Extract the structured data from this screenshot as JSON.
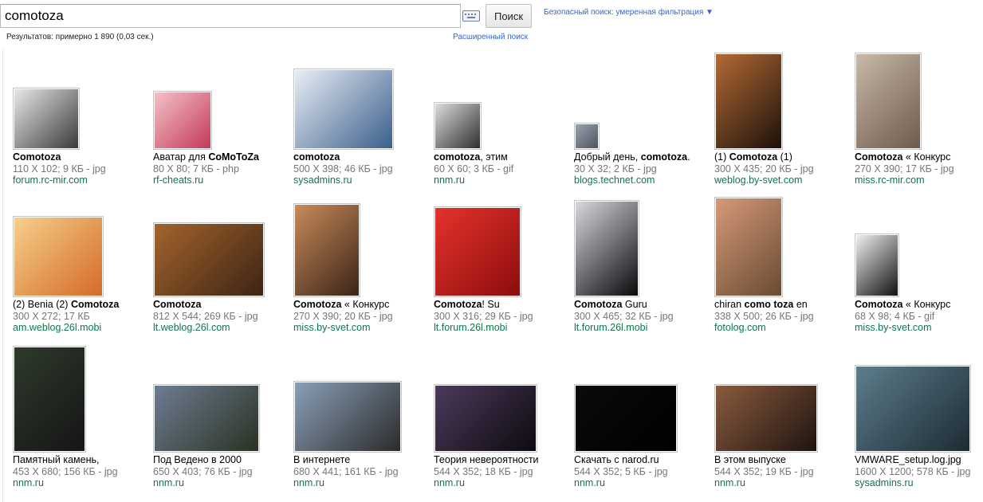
{
  "search": {
    "query": "comotoza",
    "button_label": "Поиск"
  },
  "safe_search": "Безопасный поиск: умеренная фильтрация ▼",
  "stats": "Результатов: примерно 1 890 (0,03 сек.)",
  "advanced_search": "Расширенный поиск",
  "results": [
    {
      "pre": "",
      "bold": "Comotoza",
      "post": "",
      "meta": "110 X 102; 9 КБ - jpg",
      "domain": "forum.rc-mir.com",
      "colors": [
        "#e8e8e8",
        "#3a3a3a"
      ]
    },
    {
      "pre": "Аватар для ",
      "bold": "CoMoToZa",
      "post": "",
      "meta": "80 X 80; 7 КБ - php",
      "domain": "rf-cheats.ru",
      "colors": [
        "#f3c1c6",
        "#c43a5a"
      ]
    },
    {
      "pre": "",
      "bold": "comotoza",
      "post": "",
      "meta": "500 X 398; 46 КБ - jpg",
      "domain": "sysadmins.ru",
      "colors": [
        "#e9eef5",
        "#3b5f8c"
      ]
    },
    {
      "pre": "",
      "bold": "comotoza",
      "post": ", этим",
      "meta": "60 X 60; 3 КБ - gif",
      "domain": "nnm.ru",
      "colors": [
        "#dcdcdc",
        "#2e2e2e"
      ]
    },
    {
      "pre": "Добрый день, ",
      "bold": "comotoza",
      "post": ".",
      "meta": "30 X 32; 2 КБ - jpg",
      "domain": "blogs.technet.com",
      "colors": [
        "#9aa3ad",
        "#4b5560"
      ]
    },
    {
      "pre": "(1) ",
      "bold": "Comotoza",
      "post": " (1)",
      "meta": "300 X 435; 20 КБ - jpg",
      "domain": "weblog.by-svet.com",
      "colors": [
        "#b46a35",
        "#1c110b"
      ]
    },
    {
      "pre": "",
      "bold": "Comotoza",
      "post": " « Конкурс",
      "meta": "270 X 390; 17 КБ - jpg",
      "domain": "miss.rc-mir.com",
      "colors": [
        "#c8b9a8",
        "#6d5a4d"
      ]
    },
    {
      "pre": "(2) Benia (2) ",
      "bold": "Comotoza",
      "post": "",
      "meta": "300 X 272; 17 КБ",
      "domain": "am.weblog.26l.mobi",
      "colors": [
        "#f5d08a",
        "#d66a2a"
      ]
    },
    {
      "pre": "",
      "bold": "Comotoza",
      "post": "",
      "meta": "812 X 544; 269 КБ - jpg",
      "domain": "lt.weblog.26l.com",
      "colors": [
        "#a3642d",
        "#3d2414"
      ]
    },
    {
      "pre": "",
      "bold": "Comotoza",
      "post": " « Конкурс",
      "meta": "270 X 390; 20 КБ - jpg",
      "domain": "miss.by-svet.com",
      "colors": [
        "#c98a5b",
        "#3a2418"
      ]
    },
    {
      "pre": "",
      "bold": "Comotoza",
      "post": "! Su",
      "meta": "300 X 316; 29 КБ - jpg",
      "domain": "lt.forum.26l.mobi",
      "colors": [
        "#e5322c",
        "#8c0d0d"
      ]
    },
    {
      "pre": "",
      "bold": "Comotoza",
      "post": " Guru",
      "meta": "300 X 465; 32 КБ - jpg",
      "domain": "lt.forum.26l.mobi",
      "colors": [
        "#d8d8e0",
        "#0a0a0c"
      ]
    },
    {
      "pre": "chiran ",
      "bold": "como toza",
      "post": " en",
      "meta": "338 X 500; 26 КБ - jpg",
      "domain": "fotolog.com",
      "colors": [
        "#d59a78",
        "#6a4a32"
      ]
    },
    {
      "pre": "",
      "bold": "Comotoza",
      "post": " « Конкурс",
      "meta": "68 X 98; 4 КБ - gif",
      "domain": "miss.by-svet.com",
      "colors": [
        "#f0f0f0",
        "#111111"
      ]
    },
    {
      "pre": "Памятный камень,",
      "bold": "",
      "post": "",
      "meta": "453 X 680; 156 КБ - jpg",
      "domain": "nnm.ru",
      "colors": [
        "#2e3a2c",
        "#151515"
      ]
    },
    {
      "pre": "Под Ведено в 2000",
      "bold": "",
      "post": "",
      "meta": "650 X 403; 76 КБ - jpg",
      "domain": "nnm.ru",
      "colors": [
        "#6e7c92",
        "#2a3222"
      ]
    },
    {
      "pre": "В интернете",
      "bold": "",
      "post": "",
      "meta": "680 X 441; 161 КБ - jpg",
      "domain": "nnm.ru",
      "colors": [
        "#8aa0b8",
        "#2b2b2b"
      ]
    },
    {
      "pre": "Теория невероятности",
      "bold": "",
      "post": "",
      "meta": "544 X 352; 18 КБ - jpg",
      "domain": "nnm.ru",
      "colors": [
        "#4b3a5a",
        "#0e0a10"
      ]
    },
    {
      "pre": "Скачать с narod.ru",
      "bold": "",
      "post": "",
      "meta": "544 X 352; 5 КБ - jpg",
      "domain": "nnm.ru",
      "colors": [
        "#0a0a0a",
        "#000000"
      ]
    },
    {
      "pre": "В этом выпуске",
      "bold": "",
      "post": "",
      "meta": "544 X 352; 19 КБ - jpg",
      "domain": "nnm.ru",
      "colors": [
        "#8a5a3e",
        "#1e1410"
      ]
    },
    {
      "pre": "VMWARE_setup.log.jpg",
      "bold": "",
      "post": "",
      "meta": "1600 X 1200; 578 КБ - jpg",
      "domain": "sysadmins.ru",
      "colors": [
        "#5d7d8c",
        "#1c2b33"
      ]
    }
  ]
}
